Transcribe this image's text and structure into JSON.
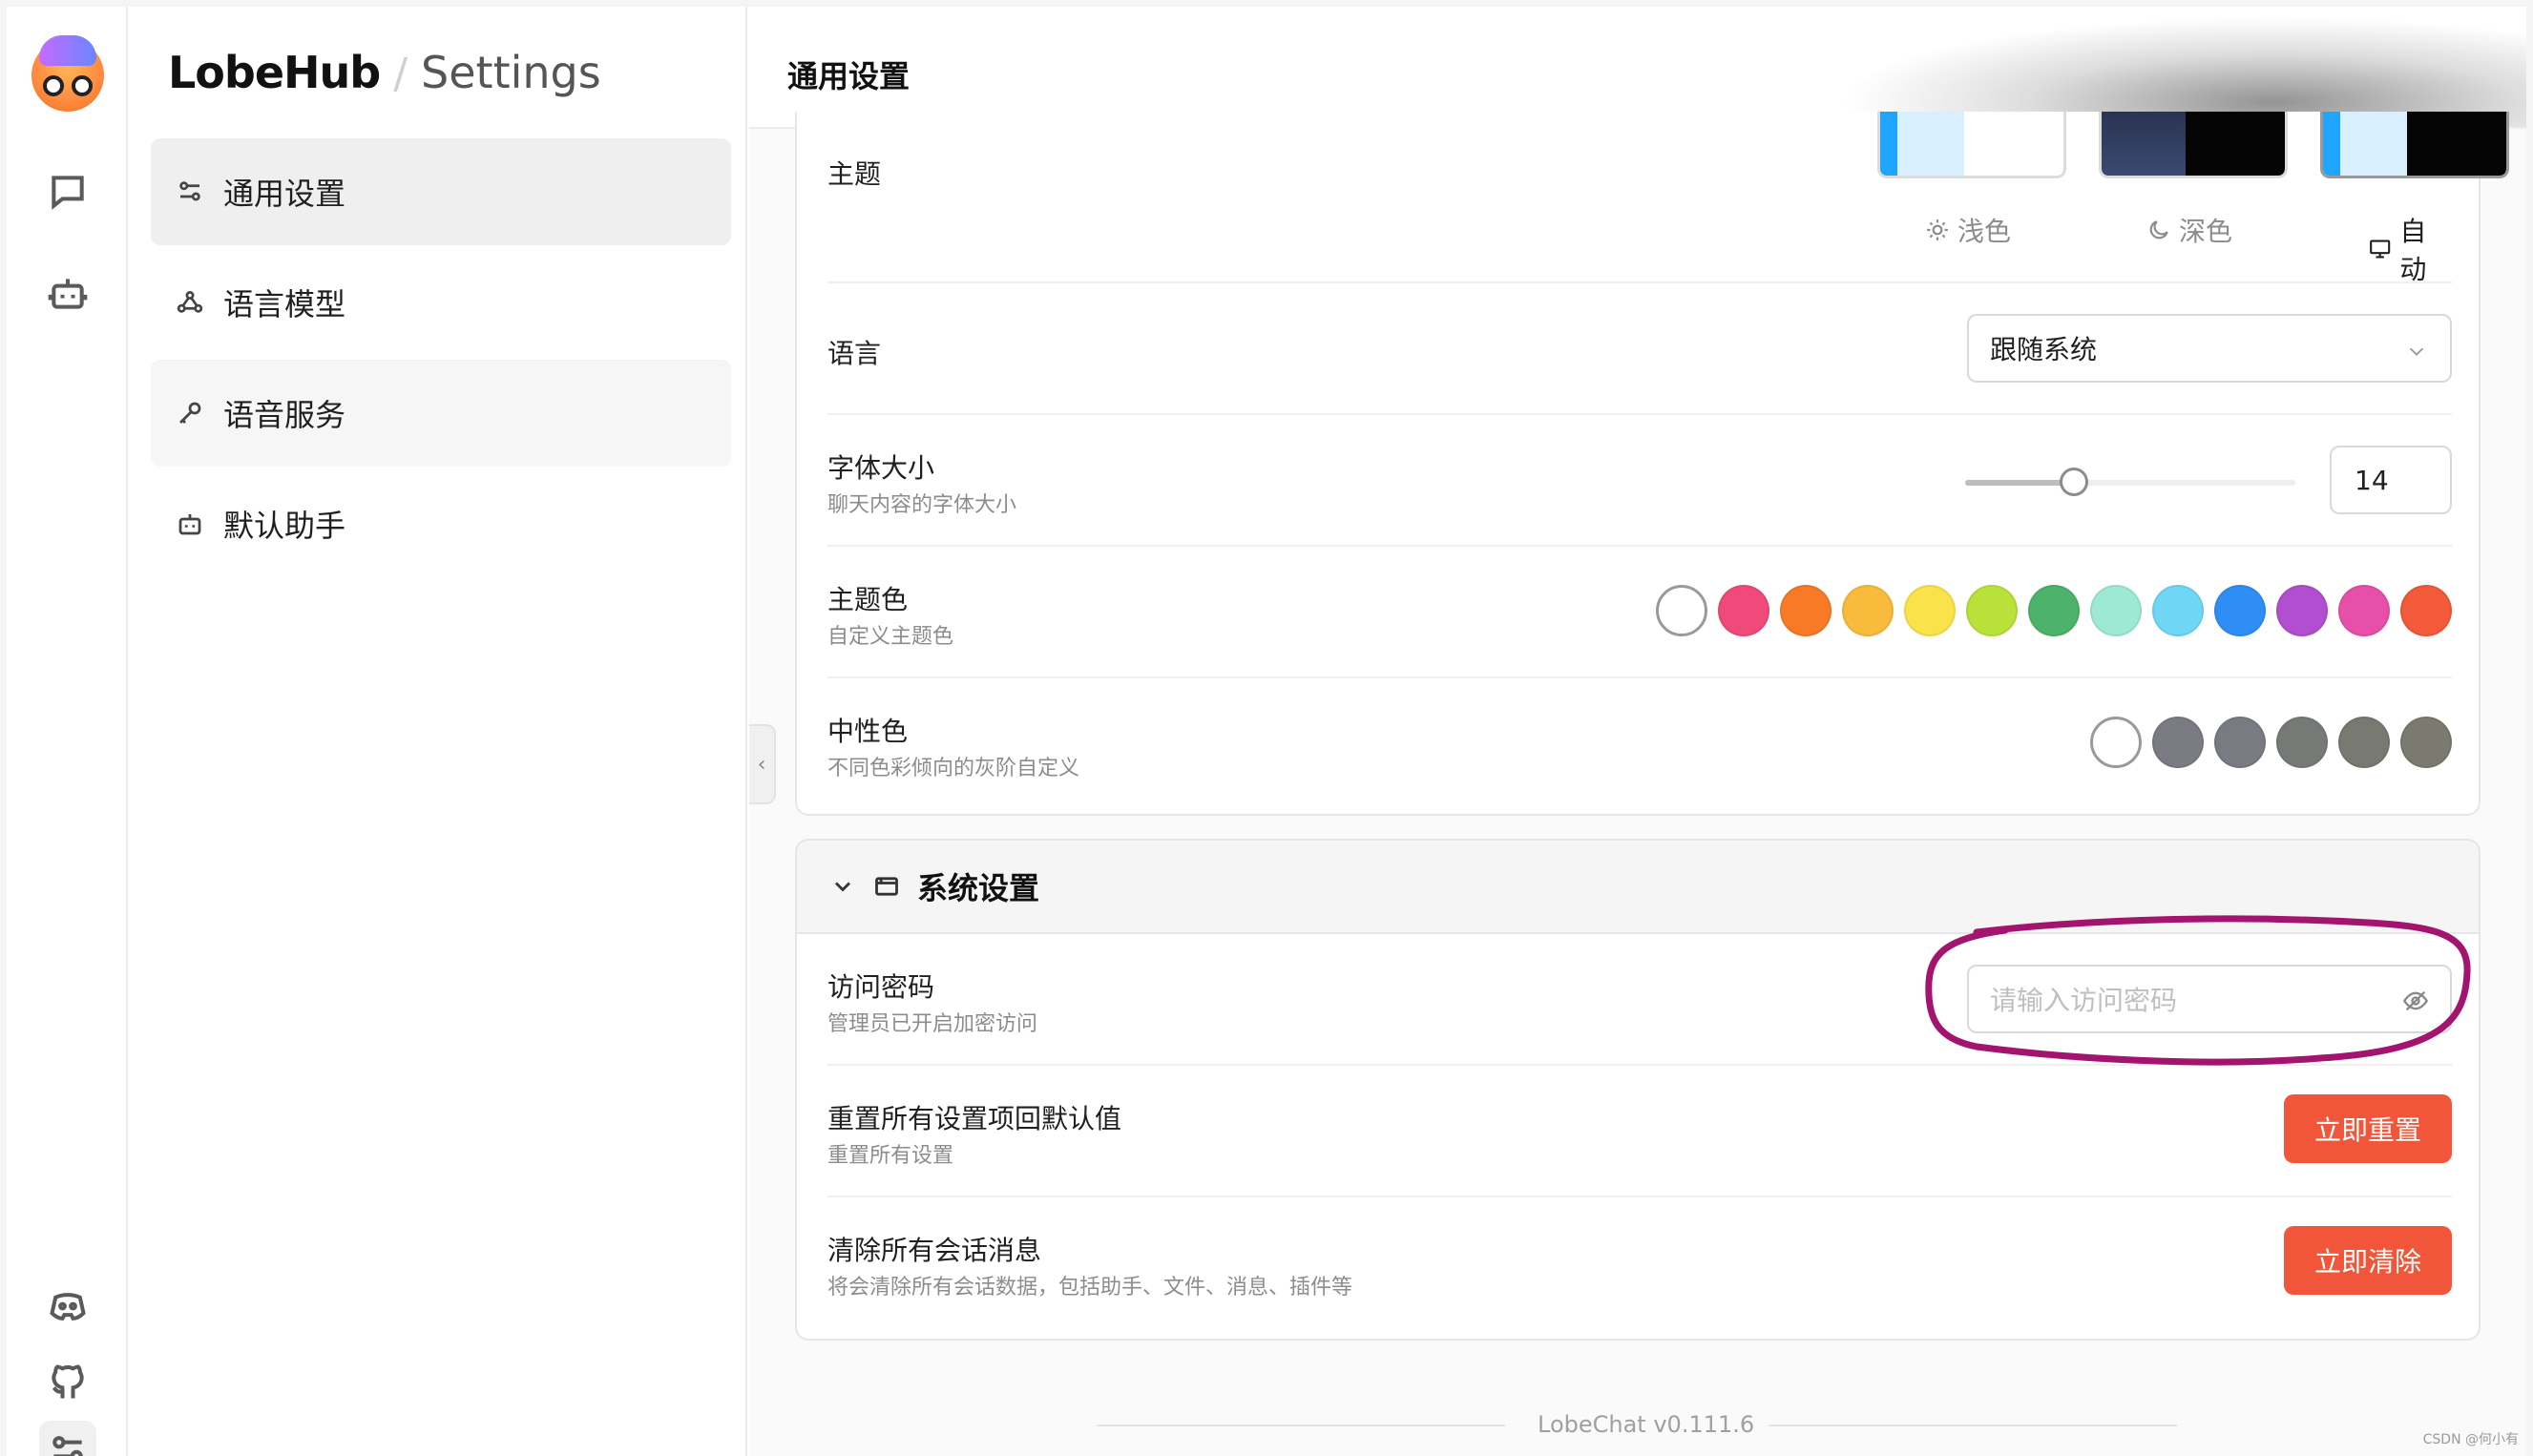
{
  "sidebar": {
    "brand": "LobeHub",
    "brand_sub": "Settings",
    "items": [
      {
        "label": "通用设置"
      },
      {
        "label": "语言模型"
      },
      {
        "label": "语音服务"
      },
      {
        "label": "默认助手"
      }
    ]
  },
  "header": {
    "title": "通用设置"
  },
  "common": {
    "theme_label": "主题",
    "theme_options": [
      "浅色",
      "深色",
      "自动"
    ],
    "theme_selected": "自动",
    "language_label": "语言",
    "language_value": "跟随系统",
    "fontsize_label": "字体大小",
    "fontsize_desc": "聊天内容的字体大小",
    "fontsize_value": "14",
    "fontsize_slider_fraction": 0.33,
    "primary_label": "主题色",
    "primary_desc": "自定义主题色",
    "primary_colors": [
      "#f04a7a",
      "#f87a26",
      "#f8bb3c",
      "#f9e24a",
      "#b8e23a",
      "#4db36c",
      "#9ee9d4",
      "#6fd6f5",
      "#2f8ef5",
      "#b24ed0",
      "#e84fa8",
      "#f25a3a"
    ],
    "neutral_label": "中性色",
    "neutral_desc": "不同色彩倾向的灰阶自定义",
    "neutral_colors": [
      "#7b7b84",
      "#787c82",
      "#767a76",
      "#787a72",
      "#7a7a70"
    ]
  },
  "system": {
    "title": "系统设置",
    "password_label": "访问密码",
    "password_desc": "管理员已开启加密访问",
    "password_placeholder": "请输入访问密码",
    "reset_label": "重置所有设置项回默认值",
    "reset_desc": "重置所有设置",
    "reset_button": "立即重置",
    "clear_label": "清除所有会话消息",
    "clear_desc": "将会清除所有会话数据，包括助手、文件、消息、插件等",
    "clear_button": "立即清除"
  },
  "footer": {
    "version": "LobeChat v0.111.6"
  },
  "watermark": "CSDN @何小有"
}
